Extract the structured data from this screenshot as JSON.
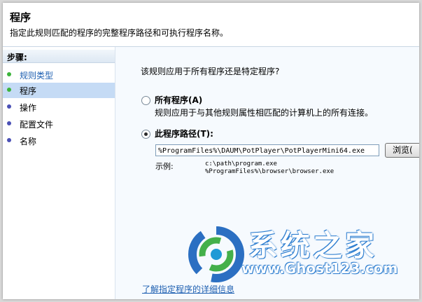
{
  "header": {
    "title": "程序",
    "subtitle": "指定此规则匹配的程序的完整程序路径和可执行程序名称。"
  },
  "sidebar": {
    "heading": "步骤:",
    "steps": [
      {
        "label": "规则类型",
        "state": "done"
      },
      {
        "label": "程序",
        "state": "active"
      },
      {
        "label": "操作",
        "state": "todo"
      },
      {
        "label": "配置文件",
        "state": "todo"
      },
      {
        "label": "名称",
        "state": "todo"
      }
    ]
  },
  "main": {
    "question": "该规则应用于所有程序还是特定程序?",
    "option_all": {
      "label": "所有程序(A)",
      "description": "规则应用于与其他规则属性相匹配的计算机上的所有连接。",
      "selected": false
    },
    "option_path": {
      "label": "此程序路径(T):",
      "selected": true,
      "value": "%ProgramFiles%\\DAUM\\PotPlayer\\PotPlayerMini64.exe"
    },
    "browse_label": "浏览(",
    "example_label": "示例:",
    "example_lines": [
      "c:\\path\\program.exe",
      "%ProgramFiles%\\browser\\browser.exe"
    ],
    "learn_more_link": "了解指定程序的详细信息"
  },
  "watermark": {
    "title": "系统之家",
    "url": "www.Ghost123.com"
  },
  "colors": {
    "selection": "#c5dbf5",
    "link": "#1d5fb1",
    "done_bullet": "#3bb43b",
    "todo_bullet": "#4a50b5"
  }
}
